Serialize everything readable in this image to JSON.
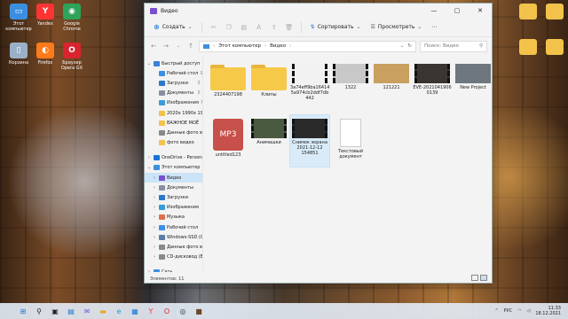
{
  "window": {
    "title": "Видео"
  },
  "toolbar": {
    "create": "Создать",
    "sort": "Сортировать",
    "view": "Просмотреть",
    "more": "⋯"
  },
  "address": {
    "crumb1": "Этот компьютер",
    "crumb2": "Видео",
    "search_placeholder": "Поиск: Видео"
  },
  "sidebar": [
    {
      "label": "Быстрый доступ",
      "icon": "star-icon",
      "color": "#3b7fd6",
      "pin": false,
      "chev": "⌄",
      "indent": 0
    },
    {
      "label": "Рабочий стол",
      "icon": "desktop-icon",
      "color": "#3c8fe0",
      "pin": true,
      "indent": 1
    },
    {
      "label": "Загрузки",
      "icon": "download-icon",
      "color": "#2b78c8",
      "pin": true,
      "indent": 1
    },
    {
      "label": "Документы",
      "icon": "document-icon",
      "color": "#8a8fa0",
      "pin": true,
      "indent": 1
    },
    {
      "label": "Изображения",
      "icon": "picture-icon",
      "color": "#3a9bd8",
      "pin": true,
      "indent": 1
    },
    {
      "label": "2020x 1990x 1980x",
      "icon": "folder-icon",
      "color": "#f2c24b",
      "pin": false,
      "indent": 1
    },
    {
      "label": "ВАЖНОЕ МОЁ",
      "icon": "folder-icon",
      "color": "#f2c24b",
      "pin": false,
      "indent": 1
    },
    {
      "label": "Данные фото видео",
      "icon": "drive-icon",
      "color": "#888888",
      "pin": false,
      "indent": 1
    },
    {
      "label": "фото видео",
      "icon": "folder-icon",
      "color": "#f2c24b",
      "pin": false,
      "indent": 1
    },
    {
      "label": "",
      "spacer": true
    },
    {
      "label": "OneDrive - Personal",
      "icon": "cloud-icon",
      "color": "#1a73d9",
      "pin": false,
      "chev": "›",
      "indent": 0
    },
    {
      "label": "Этот компьютер",
      "icon": "computer-icon",
      "color": "#3c8fe0",
      "pin": false,
      "chev": "⌄",
      "indent": 0
    },
    {
      "label": "Видео",
      "icon": "video-icon",
      "color": "#7a4fd0",
      "pin": false,
      "chev": "›",
      "indent": 1,
      "selected": true
    },
    {
      "label": "Документы",
      "icon": "document-icon",
      "color": "#8a8fa0",
      "pin": false,
      "chev": "›",
      "indent": 1
    },
    {
      "label": "Загрузки",
      "icon": "download-icon",
      "color": "#2b78c8",
      "pin": false,
      "chev": "›",
      "indent": 1
    },
    {
      "label": "Изображения",
      "icon": "picture-icon",
      "color": "#3a9bd8",
      "pin": false,
      "chev": "›",
      "indent": 1
    },
    {
      "label": "Музыка",
      "icon": "music-icon",
      "color": "#e0704a",
      "pin": false,
      "chev": "›",
      "indent": 1
    },
    {
      "label": "Рабочий стол",
      "icon": "desktop-icon",
      "color": "#3c8fe0",
      "pin": false,
      "chev": "›",
      "indent": 1
    },
    {
      "label": "Windows-SSD (C:)",
      "icon": "drive-icon",
      "color": "#5a7ca8",
      "pin": false,
      "chev": "›",
      "indent": 1
    },
    {
      "label": "Данные фото видео",
      "icon": "drive-icon",
      "color": "#888888",
      "pin": false,
      "chev": "›",
      "indent": 1
    },
    {
      "label": "CD-дисковод (E:)",
      "icon": "disc-icon",
      "color": "#888888",
      "pin": false,
      "chev": "›",
      "indent": 1
    },
    {
      "label": "",
      "spacer": true
    },
    {
      "label": "Сеть",
      "icon": "network-icon",
      "color": "#3c8fe0",
      "pin": false,
      "chev": "›",
      "indent": 0
    }
  ],
  "files": [
    {
      "name": "2324407198",
      "kind": "folder"
    },
    {
      "name": "Клипы",
      "kind": "folder"
    },
    {
      "name": "3a74eff9ba16414 5a974cb2ddf7db 442",
      "kind": "video",
      "thumb": "#f2f2f2"
    },
    {
      "name": "1322",
      "kind": "video",
      "thumb": "#c8c8c8"
    },
    {
      "name": "121221",
      "kind": "image",
      "thumb": "#c9a060"
    },
    {
      "name": "EVE-2021041906 0139",
      "kind": "video",
      "thumb": "#3a3530"
    },
    {
      "name": "New Project",
      "kind": "image",
      "thumb": "#6e7680"
    },
    {
      "name": "untitled123",
      "kind": "mp3",
      "thumb": "#c8504a",
      "badge": "MP3"
    },
    {
      "name": "Анимашки",
      "kind": "video",
      "thumb": "#4a5a40"
    },
    {
      "name": "Снимок экрана 2021-12-12 154851",
      "kind": "video",
      "thumb": "#2a2a2a",
      "selected": true
    },
    {
      "name": "Текстовый документ",
      "kind": "doc",
      "thumb": "#ffffff"
    }
  ],
  "status": {
    "count": "Элементов: 11"
  },
  "desktop_left": [
    {
      "label": "Этот компьютер",
      "color": "#3c8fe0",
      "glyph": "▭"
    },
    {
      "label": "Yandex",
      "color": "#ff3333",
      "glyph": "Y"
    },
    {
      "label": "Google Chrome",
      "color": "#2ea35a",
      "glyph": "◉"
    },
    {
      "label": "Корзина",
      "color": "#9ab0c8",
      "glyph": "▯"
    },
    {
      "label": "Firefox",
      "color": "#ff7a1a",
      "glyph": "◐"
    },
    {
      "label": "Браузер Opera GX",
      "color": "#d9232f",
      "glyph": "O"
    }
  ],
  "desktop_right": [
    {
      "label": "",
      "color": "#f2c24b",
      "glyph": ""
    },
    {
      "label": "",
      "color": "#f2c24b",
      "glyph": ""
    },
    {
      "label": "",
      "color": "#f2c24b",
      "glyph": ""
    },
    {
      "label": "",
      "color": "#f2c24b",
      "glyph": ""
    }
  ],
  "taskbar": {
    "icons": [
      {
        "name": "windows-start-icon",
        "glyph": "⊞",
        "color": "#1a73d9"
      },
      {
        "name": "search-icon",
        "glyph": "⚲",
        "color": "#222"
      },
      {
        "name": "task-view-icon",
        "glyph": "▣",
        "color": "#222"
      },
      {
        "name": "widgets-icon",
        "glyph": "▤",
        "color": "#1a73d9"
      },
      {
        "name": "chat-icon",
        "glyph": "✉",
        "color": "#6a5bd6"
      },
      {
        "name": "file-explorer-icon",
        "glyph": "▬",
        "color": "#e6a817"
      },
      {
        "name": "edge-icon",
        "glyph": "e",
        "color": "#1a9bd8"
      },
      {
        "name": "store-icon",
        "glyph": "▦",
        "color": "#1a73d9"
      },
      {
        "name": "yandex-icon",
        "glyph": "Y",
        "color": "#ff3333"
      },
      {
        "name": "opera-icon",
        "glyph": "O",
        "color": "#d9232f"
      },
      {
        "name": "steam-icon",
        "glyph": "◎",
        "color": "#1b3350"
      },
      {
        "name": "minecraft-icon",
        "glyph": "■",
        "color": "#6b4a2a"
      }
    ],
    "lang": "РУС",
    "time": "11:33",
    "date": "18.12.2021"
  }
}
